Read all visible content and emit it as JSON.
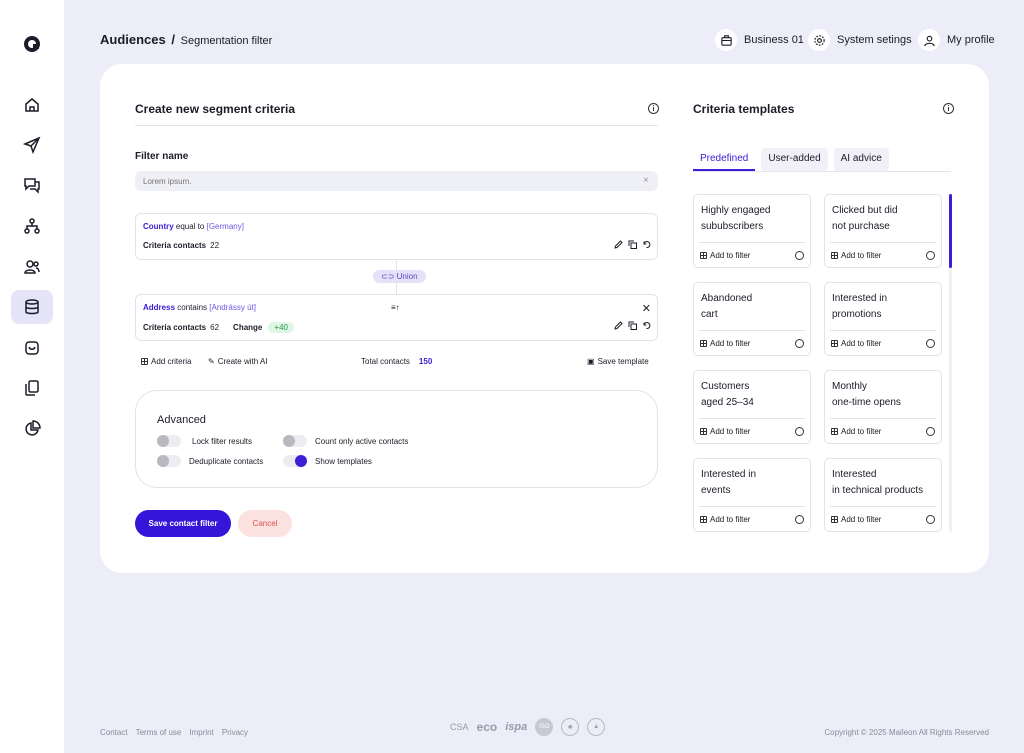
{
  "breadcrumb": {
    "root": "Audiences",
    "separator": "/",
    "current": "Segmentation filter"
  },
  "topnav": {
    "business": "Business 01",
    "settings": "System setings",
    "profile": "My profile"
  },
  "sidebar": {
    "items": [
      {
        "icon": "home-icon"
      },
      {
        "icon": "send-icon"
      },
      {
        "icon": "chat-icon"
      },
      {
        "icon": "flow-icon"
      },
      {
        "icon": "users-icon"
      },
      {
        "icon": "database-icon",
        "active": true
      },
      {
        "icon": "inbox-icon"
      },
      {
        "icon": "copy-icon"
      },
      {
        "icon": "pie-chart-icon"
      }
    ]
  },
  "segment": {
    "title": "Create new segment criteria",
    "filter_name_label": "Filter name",
    "filter_name_placeholder": "Lorem ipsum.",
    "criteria": [
      {
        "field": "Country",
        "operator": "equal to",
        "value": "[Germany]",
        "contacts_label": "Criteria contacts",
        "contacts": "22"
      },
      {
        "field": "Address",
        "operator": "contains",
        "value": "[Andrássy út]",
        "contacts_label": "Criteria contacts",
        "contacts": "62",
        "change_label": "Change",
        "change": "+40"
      }
    ],
    "union_label": "Union",
    "add_criteria": "Add criteria",
    "create_ai": "Create with AI",
    "total_label": "Total contacts",
    "total": "150",
    "save_template": "Save template",
    "advanced": {
      "title": "Advanced",
      "toggles": [
        {
          "label": "Lock filter results",
          "on": false
        },
        {
          "label": "Count only active contacts",
          "on": false
        },
        {
          "label": "Deduplicate contacts",
          "on": false
        },
        {
          "label": "Show templates",
          "on": true
        }
      ]
    },
    "save_button": "Save contact filter",
    "cancel_button": "Cancel"
  },
  "templates": {
    "title": "Criteria templates",
    "tabs": [
      "Predefined",
      "User-added",
      "AI advice"
    ],
    "active_tab": "Predefined",
    "add_label": "Add to filter",
    "items": [
      {
        "line1": "Highly engaged",
        "line2": "sububscribers"
      },
      {
        "line1": "Clicked but did",
        "line2": "not purchase"
      },
      {
        "line1": "Abandoned",
        "line2": "cart"
      },
      {
        "line1": "Interested in",
        "line2": "promotions"
      },
      {
        "line1": "Customers",
        "line2": "aged 25–34"
      },
      {
        "line1": "Monthly",
        "line2": "one-time opens"
      },
      {
        "line1": "Interested in",
        "line2": "events"
      },
      {
        "line1": "Interested",
        "line2": "in technical products"
      }
    ]
  },
  "footer": {
    "links": [
      "Contact",
      "Terms of use",
      "Imprint",
      "Privacy"
    ],
    "certs": [
      "CSA",
      "eco",
      "ispa"
    ],
    "copyright": "Copyright © 2025 Maileon All Rights Reserved"
  },
  "colors": {
    "accent": "#3515d8",
    "background": "#ededf9",
    "cancel": "#fbe1df",
    "positive": "#2f9a4c"
  }
}
